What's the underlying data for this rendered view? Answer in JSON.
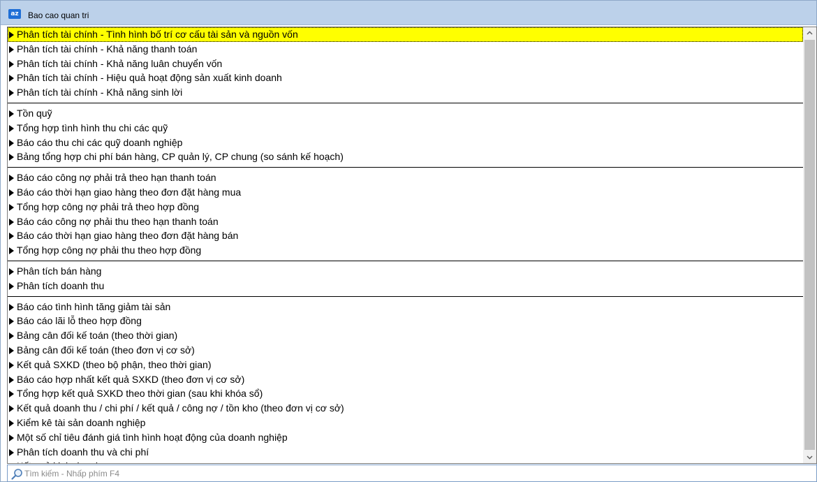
{
  "window": {
    "title": "Bao cao quan tri",
    "app_icon_text": "az"
  },
  "groups": [
    {
      "items": [
        "Phân tích tài chính - Tình hình bố trí cơ cấu tài sản và nguồn vốn",
        "Phân tích tài chính - Khả năng thanh toán",
        "Phân tích tài chính - Khả năng luân chuyển vốn",
        "Phân tích tài chính - Hiệu quả hoạt động sản xuất kinh doanh",
        "Phân tích tài chính - Khả năng sinh lời"
      ]
    },
    {
      "items": [
        "Tồn quỹ",
        "Tổng hợp tình hình thu chi các quỹ",
        "Báo cáo thu chi các quỹ doanh nghiệp",
        "Bảng tổng hợp chi phí bán hàng, CP quản lý, CP chung (so sánh kế hoạch)"
      ]
    },
    {
      "items": [
        "Báo cáo công nợ phải trả theo hạn thanh toán",
        "Báo cáo thời hạn giao hàng theo đơn đặt hàng mua",
        "Tổng hợp công nợ phải trả theo hợp đồng",
        "Báo cáo công nợ phải thu theo hạn thanh toán",
        "Báo cáo thời hạn giao hàng theo đơn đặt hàng bán",
        "Tổng hợp công nợ phải thu theo hợp đồng"
      ]
    },
    {
      "items": [
        "Phân tích bán hàng",
        "Phân tích doanh thu"
      ]
    },
    {
      "items": [
        "Báo cáo tình hình tăng giảm tài sản",
        "Báo cáo lãi lỗ theo hợp đồng",
        "Bảng cân đối kế toán (theo thời gian)",
        "Bảng cân đối kế toán (theo đơn vị cơ sở)",
        "Kết quả SXKD (theo bộ phận, theo thời gian)",
        "Báo cáo hợp nhất kết quả SXKD (theo đơn vị cơ sở)",
        "Tổng hợp kết quả SXKD theo thời gian (sau khi khóa sổ)",
        "Kết quả doanh thu / chi phí / kết quả / công nợ / tồn kho (theo đơn vị cơ sở)",
        "Kiểm kê tài sản doanh nghiệp",
        "Một số chỉ tiêu đánh giá tình hình hoạt động của doanh nghiệp",
        "Phân tích doanh thu và chi phí",
        "Kết quả kinh doanh"
      ]
    }
  ],
  "selected_item": "Phân tích tài chính - Tình hình bố trí cơ cấu tài sản và nguồn vốn",
  "search": {
    "placeholder": "Tìm kiếm - Nhấp phím F4",
    "value": ""
  },
  "colors": {
    "selection_bg": "#ffff00",
    "titlebar_bg": "#bcd1ea",
    "scroll_thumb": "#c2c2c2"
  }
}
